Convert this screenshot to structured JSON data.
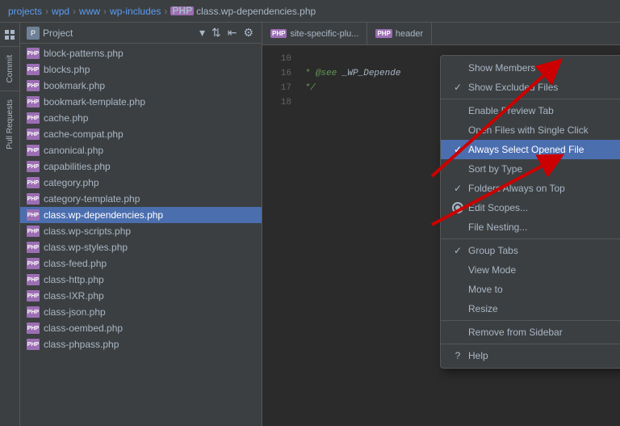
{
  "titlebar": {
    "crumbs": [
      "projects",
      "wpd",
      "www",
      "wp-includes",
      "class.wp-dependencies.php"
    ]
  },
  "project_header": {
    "title": "Project",
    "dropdown_icon": "▾"
  },
  "toolbar": {
    "sort_icon": "⇅",
    "collapse_icon": "⇤",
    "settings_icon": "⚙"
  },
  "files": [
    {
      "name": "block-patterns.php",
      "icon": "PHP"
    },
    {
      "name": "blocks.php",
      "icon": "PHP"
    },
    {
      "name": "bookmark.php",
      "icon": "PHP"
    },
    {
      "name": "bookmark-template.php",
      "icon": "PHP"
    },
    {
      "name": "cache.php",
      "icon": "PHP"
    },
    {
      "name": "cache-compat.php",
      "icon": "PHP"
    },
    {
      "name": "canonical.php",
      "icon": "PHP"
    },
    {
      "name": "capabilities.php",
      "icon": "PHP"
    },
    {
      "name": "category.php",
      "icon": "PHP"
    },
    {
      "name": "category-template.php",
      "icon": "PHP"
    },
    {
      "name": "class.wp-dependencies.php",
      "icon": "PHP",
      "selected": true
    },
    {
      "name": "class.wp-scripts.php",
      "icon": "PHP"
    },
    {
      "name": "class.wp-styles.php",
      "icon": "PHP"
    },
    {
      "name": "class-feed.php",
      "icon": "PHP"
    },
    {
      "name": "class-http.php",
      "icon": "PHP"
    },
    {
      "name": "class-IXR.php",
      "icon": "PHP"
    },
    {
      "name": "class-json.php",
      "icon": "PHP"
    },
    {
      "name": "class-oembed.php",
      "icon": "PHP"
    },
    {
      "name": "class-phpass.php",
      "icon": "PHP"
    }
  ],
  "editor_tabs": [
    {
      "label": "site-specific-plu...",
      "active": false
    },
    {
      "label": "header",
      "active": false
    }
  ],
  "code_lines": [
    {
      "num": "10",
      "content": ""
    },
    {
      "num": "16",
      "content": " * @see _WP_Depende"
    },
    {
      "num": "17",
      "content": " */"
    },
    {
      "num": "18",
      "content": ""
    }
  ],
  "context_menu": {
    "items": [
      {
        "id": "show-members",
        "label": "Show Members",
        "check": "",
        "has_arrow": false,
        "active": false,
        "type": "normal"
      },
      {
        "id": "show-excluded",
        "label": "Show Excluded Files",
        "check": "✓",
        "has_arrow": false,
        "active": false,
        "type": "check"
      },
      {
        "id": "divider1",
        "type": "divider"
      },
      {
        "id": "enable-preview",
        "label": "Enable Preview Tab",
        "check": "",
        "has_arrow": false,
        "active": false,
        "type": "normal"
      },
      {
        "id": "open-single-click",
        "label": "Open Files with Single Click",
        "check": "",
        "has_arrow": false,
        "active": false,
        "type": "normal"
      },
      {
        "id": "always-select",
        "label": "Always Select Opened File",
        "check": "✓",
        "has_arrow": false,
        "active": true,
        "type": "check"
      },
      {
        "id": "sort-by-type",
        "label": "Sort by Type",
        "check": "",
        "has_arrow": false,
        "active": false,
        "type": "normal"
      },
      {
        "id": "folders-on-top",
        "label": "Folders Always on Top",
        "check": "✓",
        "has_arrow": false,
        "active": false,
        "type": "check"
      },
      {
        "id": "edit-scopes",
        "label": "Edit Scopes...",
        "check": "",
        "has_arrow": false,
        "active": false,
        "type": "radio"
      },
      {
        "id": "file-nesting",
        "label": "File Nesting...",
        "check": "",
        "has_arrow": false,
        "active": false,
        "type": "normal"
      },
      {
        "id": "divider2",
        "type": "divider"
      },
      {
        "id": "group-tabs",
        "label": "Group Tabs",
        "check": "✓",
        "has_arrow": false,
        "active": false,
        "type": "check"
      },
      {
        "id": "view-mode",
        "label": "View Mode",
        "check": "",
        "has_arrow": true,
        "active": false,
        "type": "submenu"
      },
      {
        "id": "move-to",
        "label": "Move to",
        "check": "",
        "has_arrow": true,
        "active": false,
        "type": "submenu"
      },
      {
        "id": "resize",
        "label": "Resize",
        "check": "",
        "has_arrow": true,
        "active": false,
        "type": "submenu"
      },
      {
        "id": "divider3",
        "type": "divider"
      },
      {
        "id": "remove-sidebar",
        "label": "Remove from Sidebar",
        "check": "",
        "has_arrow": false,
        "active": false,
        "type": "normal"
      },
      {
        "id": "divider4",
        "type": "divider"
      },
      {
        "id": "help",
        "label": "Help",
        "check": "?",
        "has_arrow": false,
        "active": false,
        "type": "normal"
      }
    ]
  },
  "sidebar_labels": [
    "Commit",
    "Pull Requests"
  ],
  "colors": {
    "accent_blue": "#4b6eaf",
    "active_menu": "#4b6eaf",
    "php_badge": "#9c6eb3",
    "text_primary": "#a9b7c6",
    "bg_dark": "#2b2b2b",
    "bg_panel": "#3c3f41"
  }
}
